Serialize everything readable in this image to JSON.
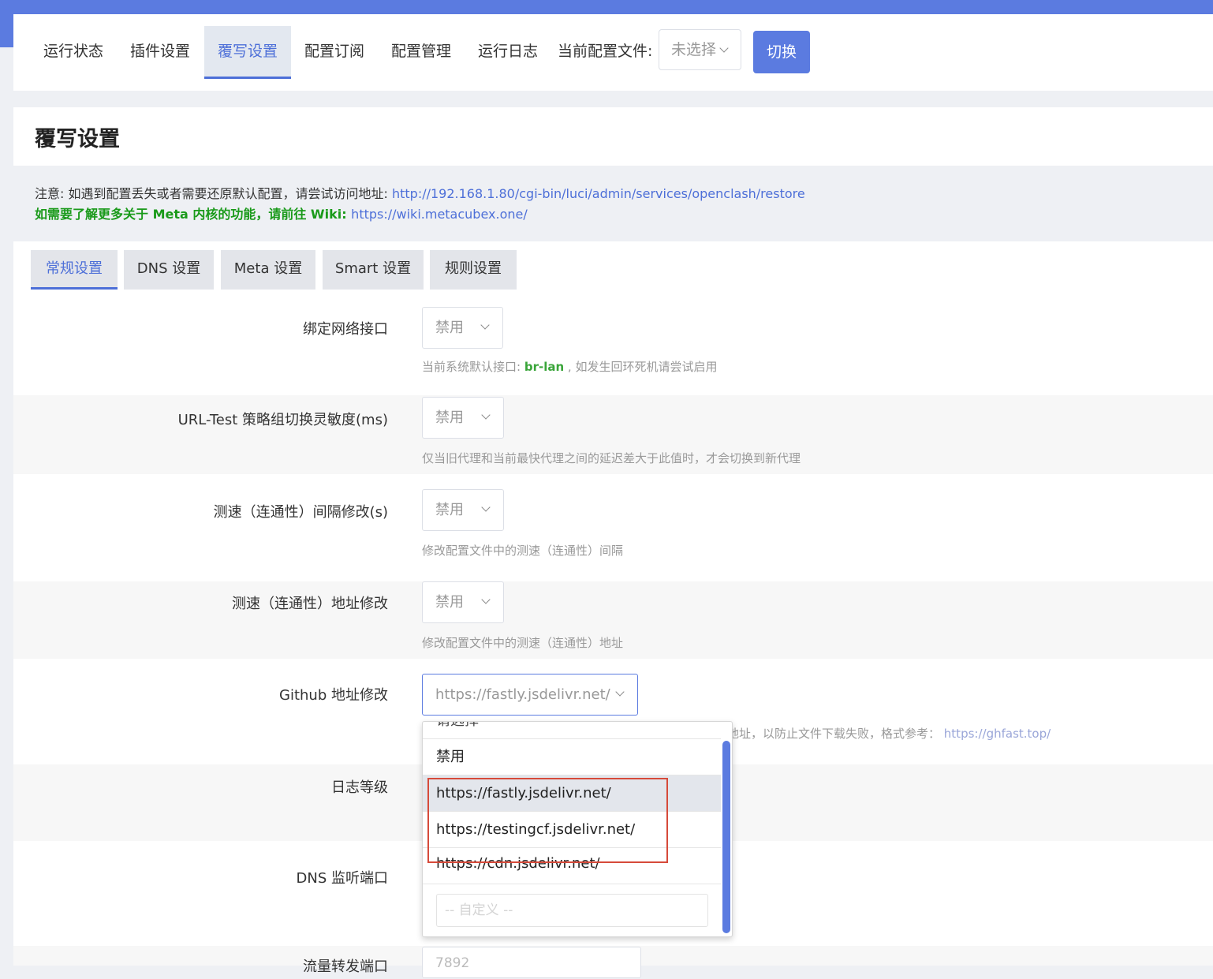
{
  "nav": {
    "items": [
      {
        "label": "运行状态"
      },
      {
        "label": "插件设置"
      },
      {
        "label": "覆写设置"
      },
      {
        "label": "配置订阅"
      },
      {
        "label": "配置管理"
      },
      {
        "label": "运行日志"
      }
    ],
    "active_item": "覆写设置",
    "current_config_label": "当前配置文件:",
    "current_config_value": "未选择",
    "switch_label": "切换"
  },
  "page": {
    "title": "覆写设置"
  },
  "notice": {
    "line1_text": "注意: 如遇到配置丢失或者需要还原默认配置，请尝试访问地址: ",
    "line1_link": "http://192.168.1.80/cgi-bin/luci/admin/services/openclash/restore",
    "line2_text": "如需要了解更多关于 Meta 内核的功能，请前往 Wiki: ",
    "line2_link": "https://wiki.metacubex.one/"
  },
  "tabs": [
    {
      "label": "常规设置"
    },
    {
      "label": "DNS 设置"
    },
    {
      "label": "Meta 设置"
    },
    {
      "label": "Smart 设置"
    },
    {
      "label": "规则设置"
    }
  ],
  "active_tab": "常规设置",
  "rows": [
    {
      "label": "绑定网络接口",
      "value": "禁用",
      "desc_prefix": "当前系统默认接口: ",
      "desc_highlight": "br-lan",
      "desc_suffix": " , 如发生回环死机请尝试启用"
    },
    {
      "label": "URL-Test 策略组切换灵敏度(ms)",
      "value": "禁用",
      "desc": "仅当旧代理和当前最快代理之间的延迟差大于此值时，才会切换到新代理"
    },
    {
      "label": "测速（连通性）间隔修改(s)",
      "value": "禁用",
      "desc": "修改配置文件中的测速（连通性）间隔"
    },
    {
      "label": "测速（连通性）地址修改",
      "value": "禁用",
      "desc": "修改配置文件中的测速（连通性）地址"
    },
    {
      "label": "Github 地址修改",
      "value": "https://fastly.jsdelivr.net/",
      "desc": "地址，以防止文件下载失败，格式参考：",
      "desc_link": "https://ghfast.top/"
    },
    {
      "label": "日志等级"
    },
    {
      "label": "DNS 监听端口"
    },
    {
      "label": "流量转发端口",
      "value": "7892"
    }
  ],
  "dropdown": {
    "options": [
      {
        "label": "请选择"
      },
      {
        "label": "禁用"
      },
      {
        "label": "https://fastly.jsdelivr.net/"
      },
      {
        "label": "https://testingcf.jsdelivr.net/"
      },
      {
        "label": "https://cdn.jsdelivr.net/"
      }
    ],
    "selected": "https://fastly.jsdelivr.net/",
    "custom_placeholder": "-- 自定义 --"
  },
  "colors": {
    "accent": "#5b7be0",
    "highlight_box": "#d64a3a",
    "green_text": "#1a9a1a"
  }
}
